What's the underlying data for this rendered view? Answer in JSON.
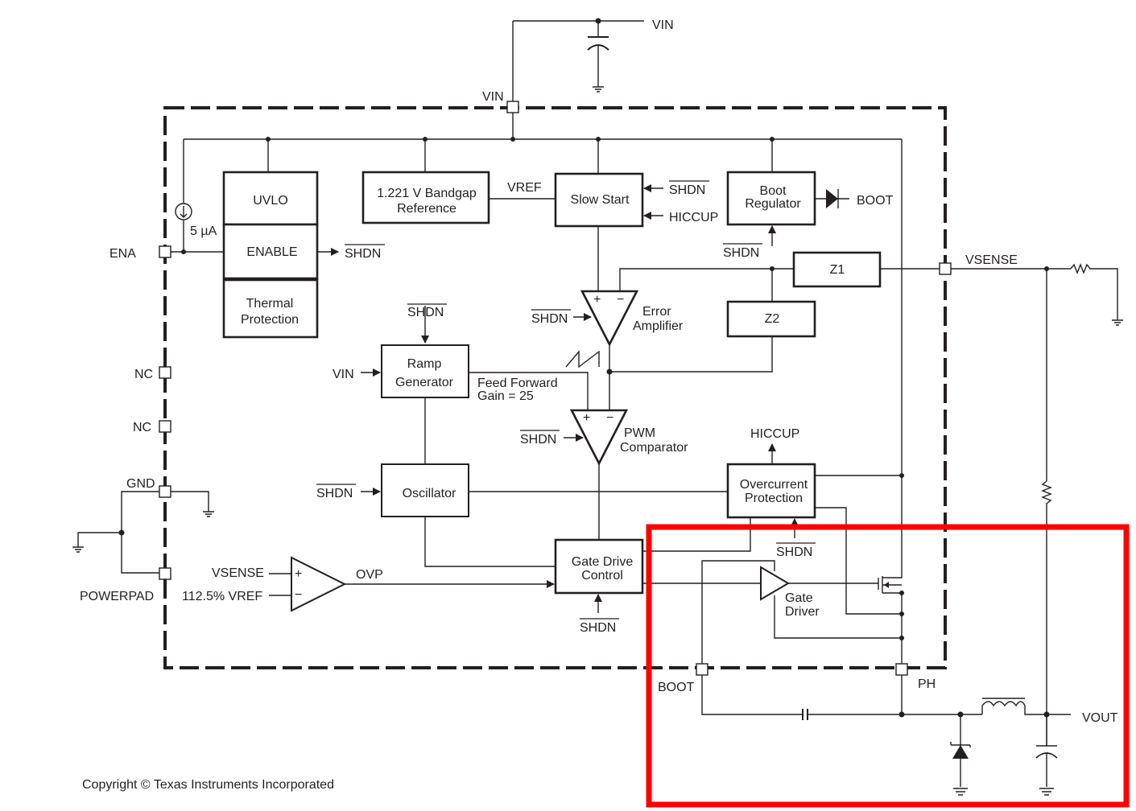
{
  "diagram": {
    "type": "functional-block-diagram",
    "external_pins": {
      "vin_top": "VIN",
      "vin_pin": "VIN",
      "ena": "ENA",
      "nc1": "NC",
      "nc2": "NC",
      "gnd": "GND",
      "powerpad": "POWERPAD",
      "vsense": "VSENSE",
      "boot_pin": "BOOT",
      "ph": "PH",
      "vout": "VOUT"
    },
    "blocks": {
      "uvlo": "UVLO",
      "enable": "ENABLE",
      "thermal_line1": "Thermal",
      "thermal_line2": "Protection",
      "bandgap_line1": "1.221 V Bandgap",
      "bandgap_line2": "Reference",
      "slow_start": "Slow Start",
      "boot_reg_line1": "Boot",
      "boot_reg_line2": "Regulator",
      "z1": "Z1",
      "z2": "Z2",
      "ramp_line1": "Ramp",
      "ramp_line2": "Generator",
      "oscillator": "Oscillator",
      "ocp_line1": "Overcurrent",
      "ocp_line2": "Protection",
      "gdc_line1": "Gate Drive",
      "gdc_line2": "Control"
    },
    "amplifiers": {
      "error_amp_line1": "Error",
      "error_amp_line2": "Amplifier",
      "pwm_line1": "PWM",
      "pwm_line2": "Comparator",
      "gate_driver_line1": "Gate",
      "gate_driver_line2": "Driver",
      "plus": "+",
      "minus": "−"
    },
    "signals": {
      "shdn": "SHDN",
      "vref": "VREF",
      "hiccup": "HICCUP",
      "boot": "BOOT",
      "vin": "VIN",
      "current_source": "5 µA",
      "feed_forward_line1": "Feed Forward",
      "feed_forward_line2": "Gain = 25",
      "ovp_vsense": "VSENSE",
      "ovp_vref": "112.5% VREF",
      "ovp": "OVP"
    },
    "highlight": {
      "color": "#ff0000",
      "region": "BOOT / PH output stage"
    },
    "copyright": "Copyright © Texas Instruments Incorporated"
  }
}
